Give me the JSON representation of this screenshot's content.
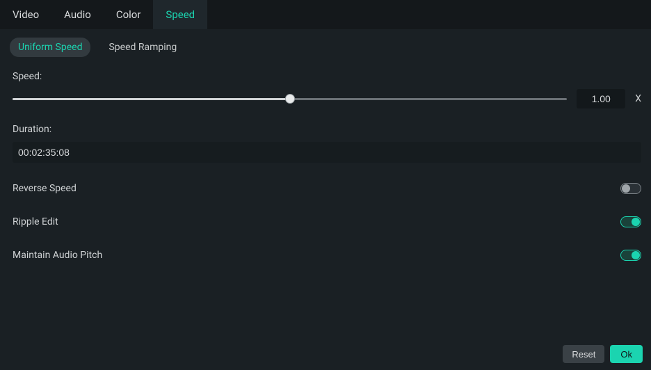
{
  "top_tabs": {
    "video": "Video",
    "audio": "Audio",
    "color": "Color",
    "speed": "Speed"
  },
  "sub_tabs": {
    "uniform": "Uniform Speed",
    "ramping": "Speed Ramping"
  },
  "speed": {
    "label": "Speed:",
    "value": "1.00",
    "unit": "X",
    "slider_percent": 50
  },
  "duration": {
    "label": "Duration:",
    "value": "00:02:35:08"
  },
  "toggles": {
    "reverse": {
      "label": "Reverse Speed",
      "on": false
    },
    "ripple": {
      "label": "Ripple Edit",
      "on": true
    },
    "pitch": {
      "label": "Maintain Audio Pitch",
      "on": true
    }
  },
  "footer": {
    "reset": "Reset",
    "ok": "Ok"
  },
  "colors": {
    "accent": "#1bd4b0",
    "bg": "#1a2024"
  }
}
